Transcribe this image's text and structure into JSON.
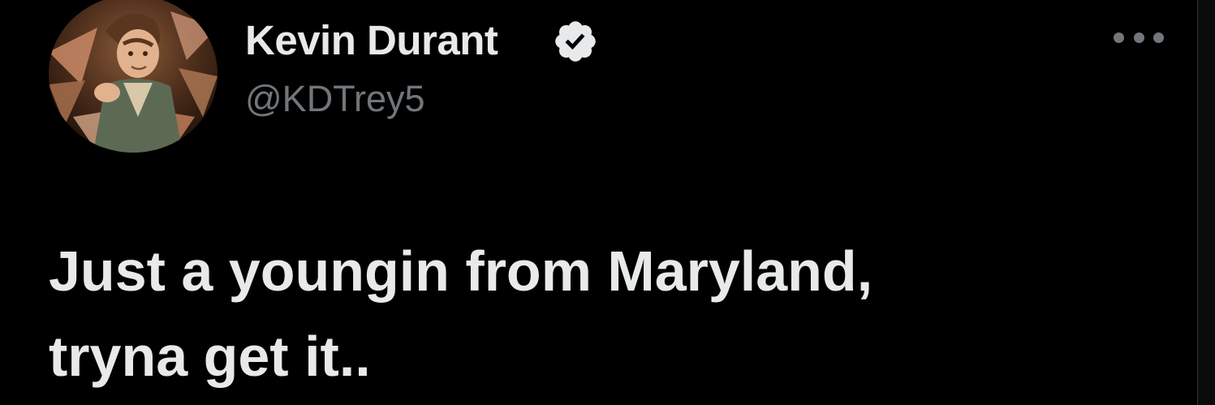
{
  "tweet": {
    "author": {
      "display_name": "Kevin Durant",
      "handle": "@KDTrey5",
      "verified": true,
      "avatar": "animated-character-avatar"
    },
    "text_lines": [
      "Just a youngin from Maryland,",
      "tryna get it.."
    ],
    "more_menu_icon": "ellipsis-icon"
  },
  "colors": {
    "background": "#000000",
    "primary_text": "#e7e9ea",
    "secondary_text": "#71767b",
    "verified_badge": "#e7e9ea"
  }
}
